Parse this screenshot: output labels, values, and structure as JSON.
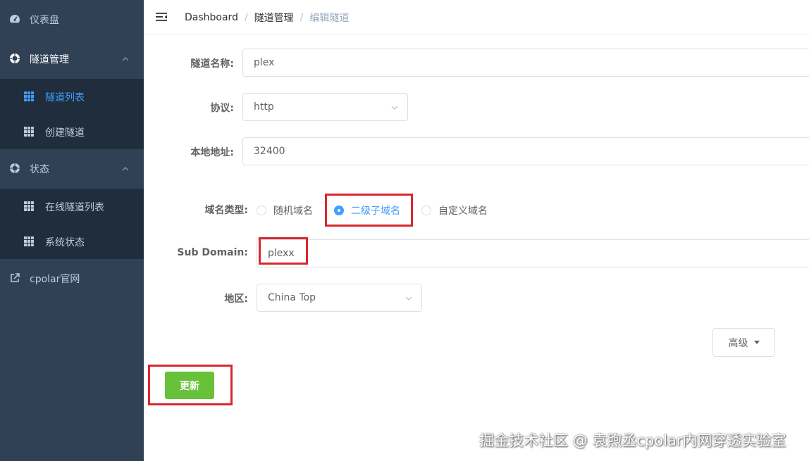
{
  "sidebar": {
    "items": [
      {
        "label": "仪表盘",
        "icon": "dashboard-icon"
      },
      {
        "label": "隧道管理",
        "icon": "tunnel-icon",
        "expanded": true,
        "children": [
          {
            "label": "隧道列表",
            "active": true,
            "icon": "table-icon"
          },
          {
            "label": "创建隧道",
            "icon": "table-icon"
          }
        ]
      },
      {
        "label": "状态",
        "icon": "status-icon",
        "expanded": true,
        "children": [
          {
            "label": "在线隧道列表",
            "icon": "table-icon"
          },
          {
            "label": "系统状态",
            "icon": "table-icon"
          }
        ]
      },
      {
        "label": "cpolar官网",
        "icon": "external-link-icon"
      }
    ]
  },
  "breadcrumb": [
    "Dashboard",
    "隧道管理",
    "编辑隧道"
  ],
  "form": {
    "tunnel_name": {
      "label": "隧道名称:",
      "value": "plex"
    },
    "protocol": {
      "label": "协议:",
      "value": "http"
    },
    "local_address": {
      "label": "本地地址:",
      "value": "32400"
    },
    "domain_type": {
      "label": "域名类型:",
      "options": [
        "随机域名",
        "二级子域名",
        "自定义域名"
      ],
      "selected": "二级子域名"
    },
    "sub_domain": {
      "label": "Sub Domain:",
      "value": "plexx"
    },
    "region": {
      "label": "地区:",
      "value": "China Top"
    }
  },
  "buttons": {
    "advanced": "高级",
    "update": "更新"
  },
  "watermark": "掘金技术社区 @ 袁煦丞cpolar内网穿透实验室",
  "colors": {
    "sidebar_bg": "#304156",
    "submenu_bg": "#1f2d3d",
    "accent": "#409eff",
    "success": "#67c23a",
    "highlight": "#d9282e"
  }
}
